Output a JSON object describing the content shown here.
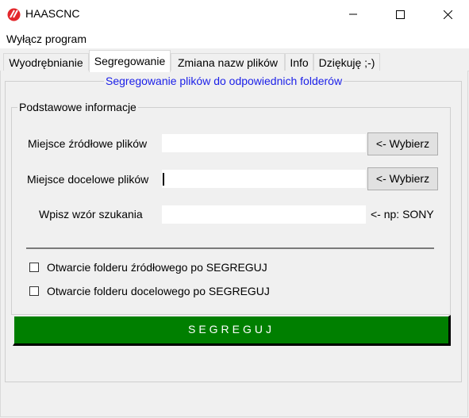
{
  "window": {
    "title": "HAASCNC",
    "controls": [
      "minimize-icon",
      "maximize-icon",
      "close-icon"
    ]
  },
  "menu": {
    "item": "Wyłącz program"
  },
  "tabs": [
    {
      "label": "Wyodrębnianie",
      "active": false
    },
    {
      "label": "Segregowanie",
      "active": true
    },
    {
      "label": "Zmiana nazw plików",
      "active": false
    },
    {
      "label": "Info",
      "active": false
    },
    {
      "label": "Dziękuję ;-)",
      "active": false
    }
  ],
  "section": {
    "title": "Segregowanie plików do odpowiednich folderów",
    "group_title": "Podstawowe informacje"
  },
  "fields": {
    "source": {
      "label": "Miejsce źródłowe plików",
      "value": "",
      "button": "<- Wybierz"
    },
    "dest": {
      "label": "Miejsce docelowe plików",
      "value": "",
      "button": "<- Wybierz"
    },
    "pattern": {
      "label": "Wpisz wzór szukania",
      "value": "",
      "hint": "<- np: SONY"
    }
  },
  "checkboxes": [
    {
      "label": "Otwarcie folderu źródłowego po SEGREGUJ",
      "checked": false
    },
    {
      "label": "Otwarcie folderu docelowego po SEGREGUJ",
      "checked": false
    }
  ],
  "primary_button": "SEGREGUJ",
  "colors": {
    "accent_title": "#1c20e8",
    "primary_button": "#007f00",
    "app_icon": "#e3262b"
  }
}
